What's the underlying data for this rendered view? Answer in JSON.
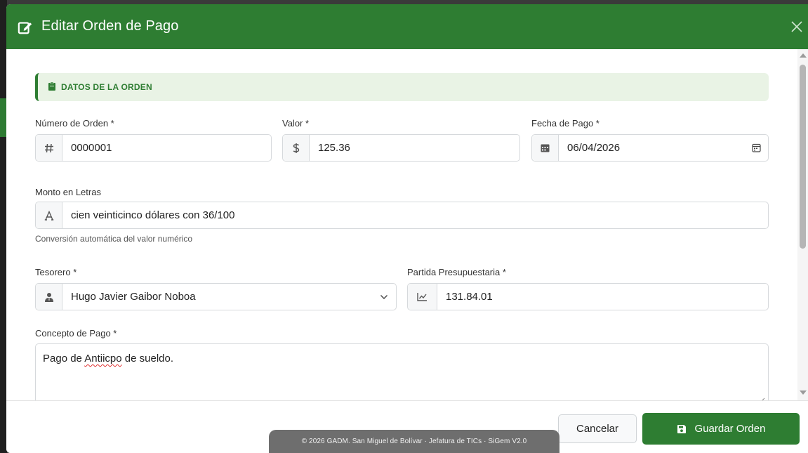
{
  "modal": {
    "title": "Editar Orden de Pago",
    "header_color": "#2e7d32"
  },
  "section": {
    "title": "DATOS DE LA ORDEN",
    "icon": "clipboard-icon"
  },
  "fields": {
    "numero_orden": {
      "label": "Número de Orden *",
      "value": "0000001",
      "icon": "hash-icon"
    },
    "valor": {
      "label": "Valor *",
      "value": "125.36",
      "icon": "dollar-icon"
    },
    "fecha_pago": {
      "label": "Fecha de Pago *",
      "value": "06/04/2026",
      "icon": "calendar-icon"
    },
    "monto_letras": {
      "label": "Monto en Letras",
      "value": "cien veinticinco dólares con 36/100",
      "help": "Conversión automática del valor numérico",
      "icon": "font-icon"
    },
    "tesorero": {
      "label": "Tesorero *",
      "value": "Hugo Javier Gaibor Noboa",
      "icon": "user-tie-icon"
    },
    "partida": {
      "label": "Partida Presupuestaria *",
      "value": "131.84.01",
      "icon": "chart-line-icon"
    },
    "concepto": {
      "label": "Concepto de Pago *",
      "value_before": "Pago de ",
      "value_misspelled": "Antiicpo",
      "value_after": " de sueldo."
    }
  },
  "footer": {
    "cancel_label": "Cancelar",
    "save_label": "Guardar Orden"
  },
  "toast": {
    "text": "© 2026 GADM. San Miguel de Bolívar · Jefatura de TICs  ·  SiGem V2.0"
  }
}
